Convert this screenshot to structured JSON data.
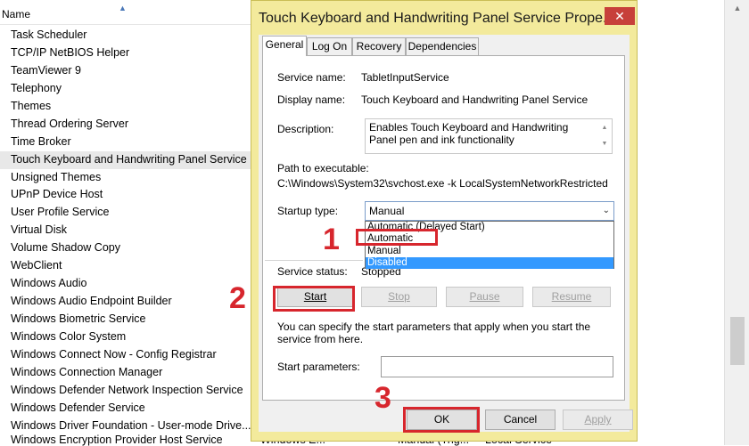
{
  "services": {
    "column_name": "Name",
    "items": [
      "Task Scheduler",
      "TCP/IP NetBIOS Helper",
      "TeamViewer 9",
      "Telephony",
      "Themes",
      "Thread Ordering Server",
      "Time Broker",
      "Touch Keyboard and Handwriting Panel Service",
      "Unsigned Themes",
      "UPnP Device Host",
      "User Profile Service",
      "Virtual Disk",
      "Volume Shadow Copy",
      "WebClient",
      "Windows Audio",
      "Windows Audio Endpoint Builder",
      "Windows Biometric Service",
      "Windows Color System",
      "Windows Connect Now - Config Registrar",
      "Windows Connection Manager",
      "Windows Defender Network Inspection Service",
      "Windows Defender Service",
      "Windows Driver Foundation - User-mode Drive..."
    ],
    "bottom_row": {
      "name": "Windows Encryption Provider Host Service",
      "description": "Windows E...",
      "startup": "Manual (Trig...",
      "logon": "Local Service"
    }
  },
  "dialog": {
    "title": "Touch Keyboard and Handwriting Panel Service Prope...",
    "close_glyph": "✕",
    "tabs": [
      "General",
      "Log On",
      "Recovery",
      "Dependencies"
    ],
    "service_name_label": "Service name:",
    "service_name_value": "TabletInputService",
    "display_name_label": "Display name:",
    "display_name_value": "Touch Keyboard and Handwriting Panel Service",
    "description_label": "Description:",
    "description_value": "Enables Touch Keyboard and Handwriting Panel pen and ink functionality",
    "path_label": "Path to executable:",
    "path_value": "C:\\Windows\\System32\\svchost.exe -k LocalSystemNetworkRestricted",
    "startup_type_label": "Startup type:",
    "startup_type_value": "Manual",
    "startup_options": [
      "Automatic (Delayed Start)",
      "Automatic",
      "Manual",
      "Disabled"
    ],
    "startup_highlighted": "Disabled",
    "service_status_label": "Service status:",
    "service_status_value": "Stopped",
    "buttons": {
      "start": "Start",
      "stop": "Stop",
      "pause": "Pause",
      "resume": "Resume",
      "ok": "OK",
      "cancel": "Cancel",
      "apply": "Apply"
    },
    "help_text": "You can specify the start parameters that apply when you start the service from here.",
    "start_params_label": "Start parameters:",
    "start_params_value": ""
  },
  "annotations": [
    "1",
    "2",
    "3"
  ],
  "colors": {
    "annotation_red": "#d7262d",
    "dialog_frame": "#f3ea9c",
    "close_button": "#c7403a",
    "dropdown_highlight": "#3399ff"
  },
  "icons": [
    "sort-ascending-icon",
    "close-icon",
    "chevron-down-icon",
    "scroll-up-icon"
  ]
}
